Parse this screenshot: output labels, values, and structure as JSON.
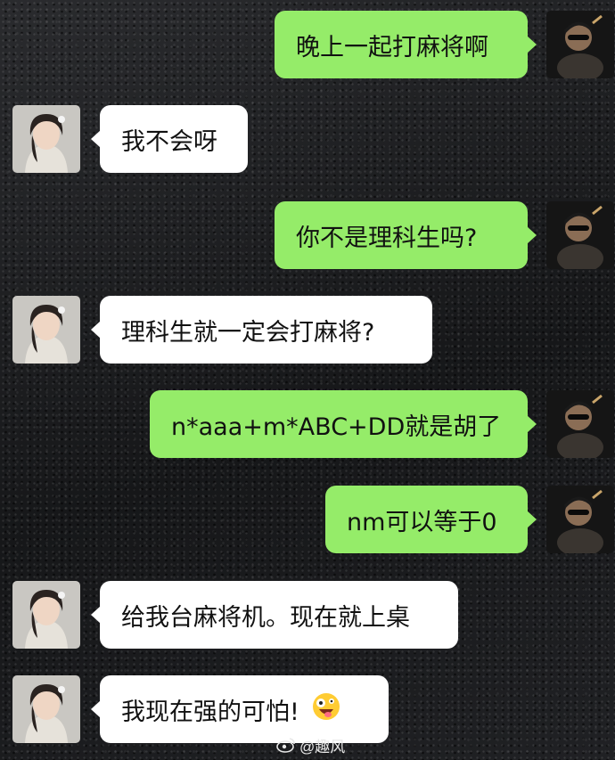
{
  "messages": [
    {
      "side": "sent",
      "text": "晚上一起打麻将啊"
    },
    {
      "side": "received",
      "text": "我不会呀"
    },
    {
      "side": "sent",
      "text": "你不是理科生吗?"
    },
    {
      "side": "received",
      "text": "理科生就一定会打麻将?"
    },
    {
      "side": "sent",
      "text": "n*aaa+m*ABC+DD就是胡了"
    },
    {
      "side": "sent",
      "text": "nm可以等于0"
    },
    {
      "side": "received",
      "text": "给我台麻将机。现在就上桌"
    },
    {
      "side": "received",
      "text": "我现在强的可怕!",
      "emoji": "crazy-face-emoji"
    }
  ],
  "watermark": {
    "icon": "weibo-logo",
    "text": "@趣风"
  },
  "colors": {
    "sent_bubble": "#95ec69",
    "received_bubble": "#ffffff",
    "background": "#1b1c1e"
  }
}
